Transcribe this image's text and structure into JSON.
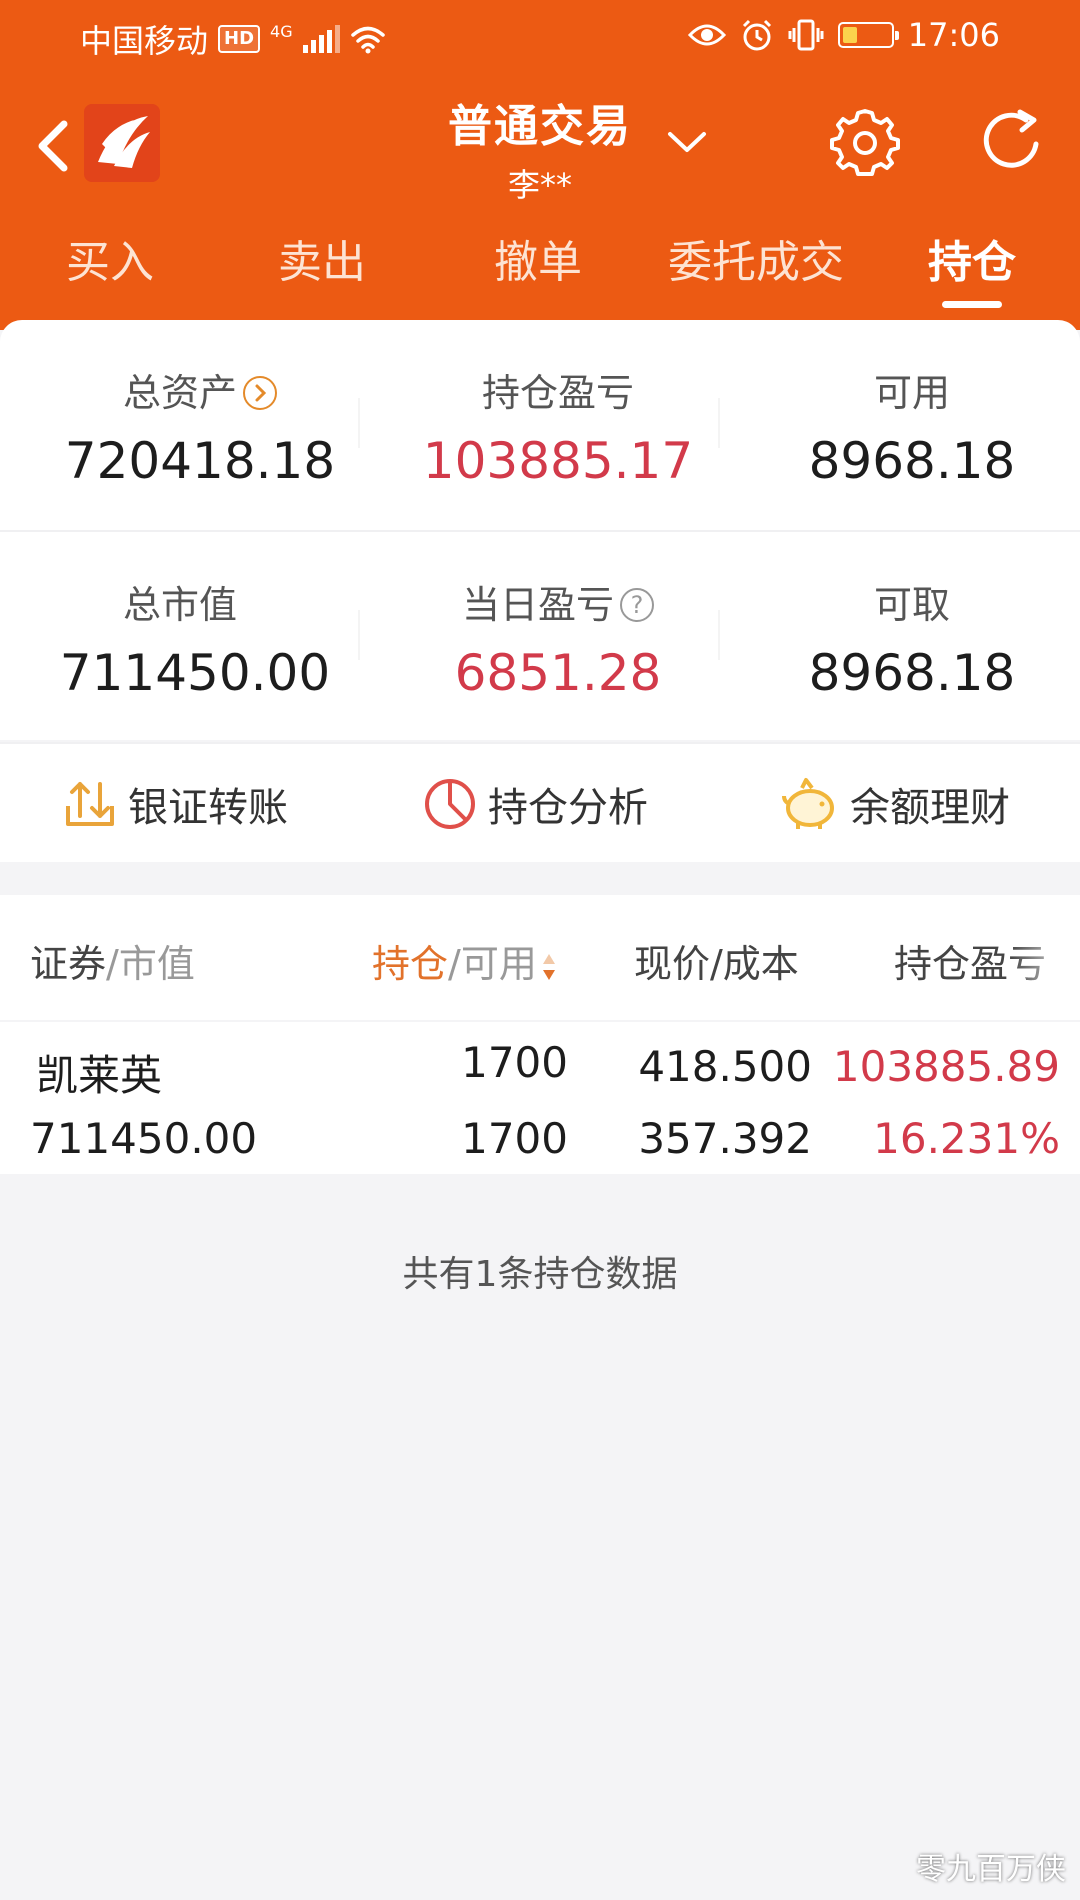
{
  "status_bar": {
    "carrier": "中国移动",
    "hd": "HD",
    "network": "4G",
    "time": "17:06"
  },
  "header": {
    "title": "普通交易",
    "account": "李**",
    "tabs": [
      {
        "label": "买入",
        "active": false
      },
      {
        "label": "卖出",
        "active": false
      },
      {
        "label": "撤单",
        "active": false
      },
      {
        "label": "委托成交",
        "active": false
      },
      {
        "label": "持仓",
        "active": true
      }
    ]
  },
  "summary": {
    "row1": [
      {
        "label": "总资产",
        "value": "720418.18"
      },
      {
        "label": "持仓盈亏",
        "value": "103885.17"
      },
      {
        "label": "可用",
        "value": "8968.18"
      }
    ],
    "row2": [
      {
        "label": "总市值",
        "value": "711450.00"
      },
      {
        "label": "当日盈亏",
        "value": "6851.28"
      },
      {
        "label": "可取",
        "value": "8968.18"
      }
    ],
    "help_glyph": "?"
  },
  "actions": [
    {
      "label": "银证转账",
      "icon": "transfer-icon"
    },
    {
      "label": "持仓分析",
      "icon": "pie-chart-icon"
    },
    {
      "label": "余额理财",
      "icon": "piggy-bank-icon"
    }
  ],
  "table": {
    "headers": {
      "security": "证券",
      "market_value": "/市值",
      "position": "持仓",
      "available": "/可用",
      "price_cost": "现价/成本",
      "pnl": "持仓盈亏"
    },
    "rows": [
      {
        "name": "凯莱英",
        "market_value": "711450.00",
        "position": "1700",
        "available": "1700",
        "price": "418.500",
        "cost": "357.392",
        "pnl": "103885.89",
        "pnl_pct": "16.231%"
      }
    ],
    "footer": "共有1条持仓数据"
  },
  "watermark": "零九百万侠",
  "colors": {
    "brand": "#ec5a13",
    "profit": "#d23a4a",
    "accent": "#e2722b"
  }
}
